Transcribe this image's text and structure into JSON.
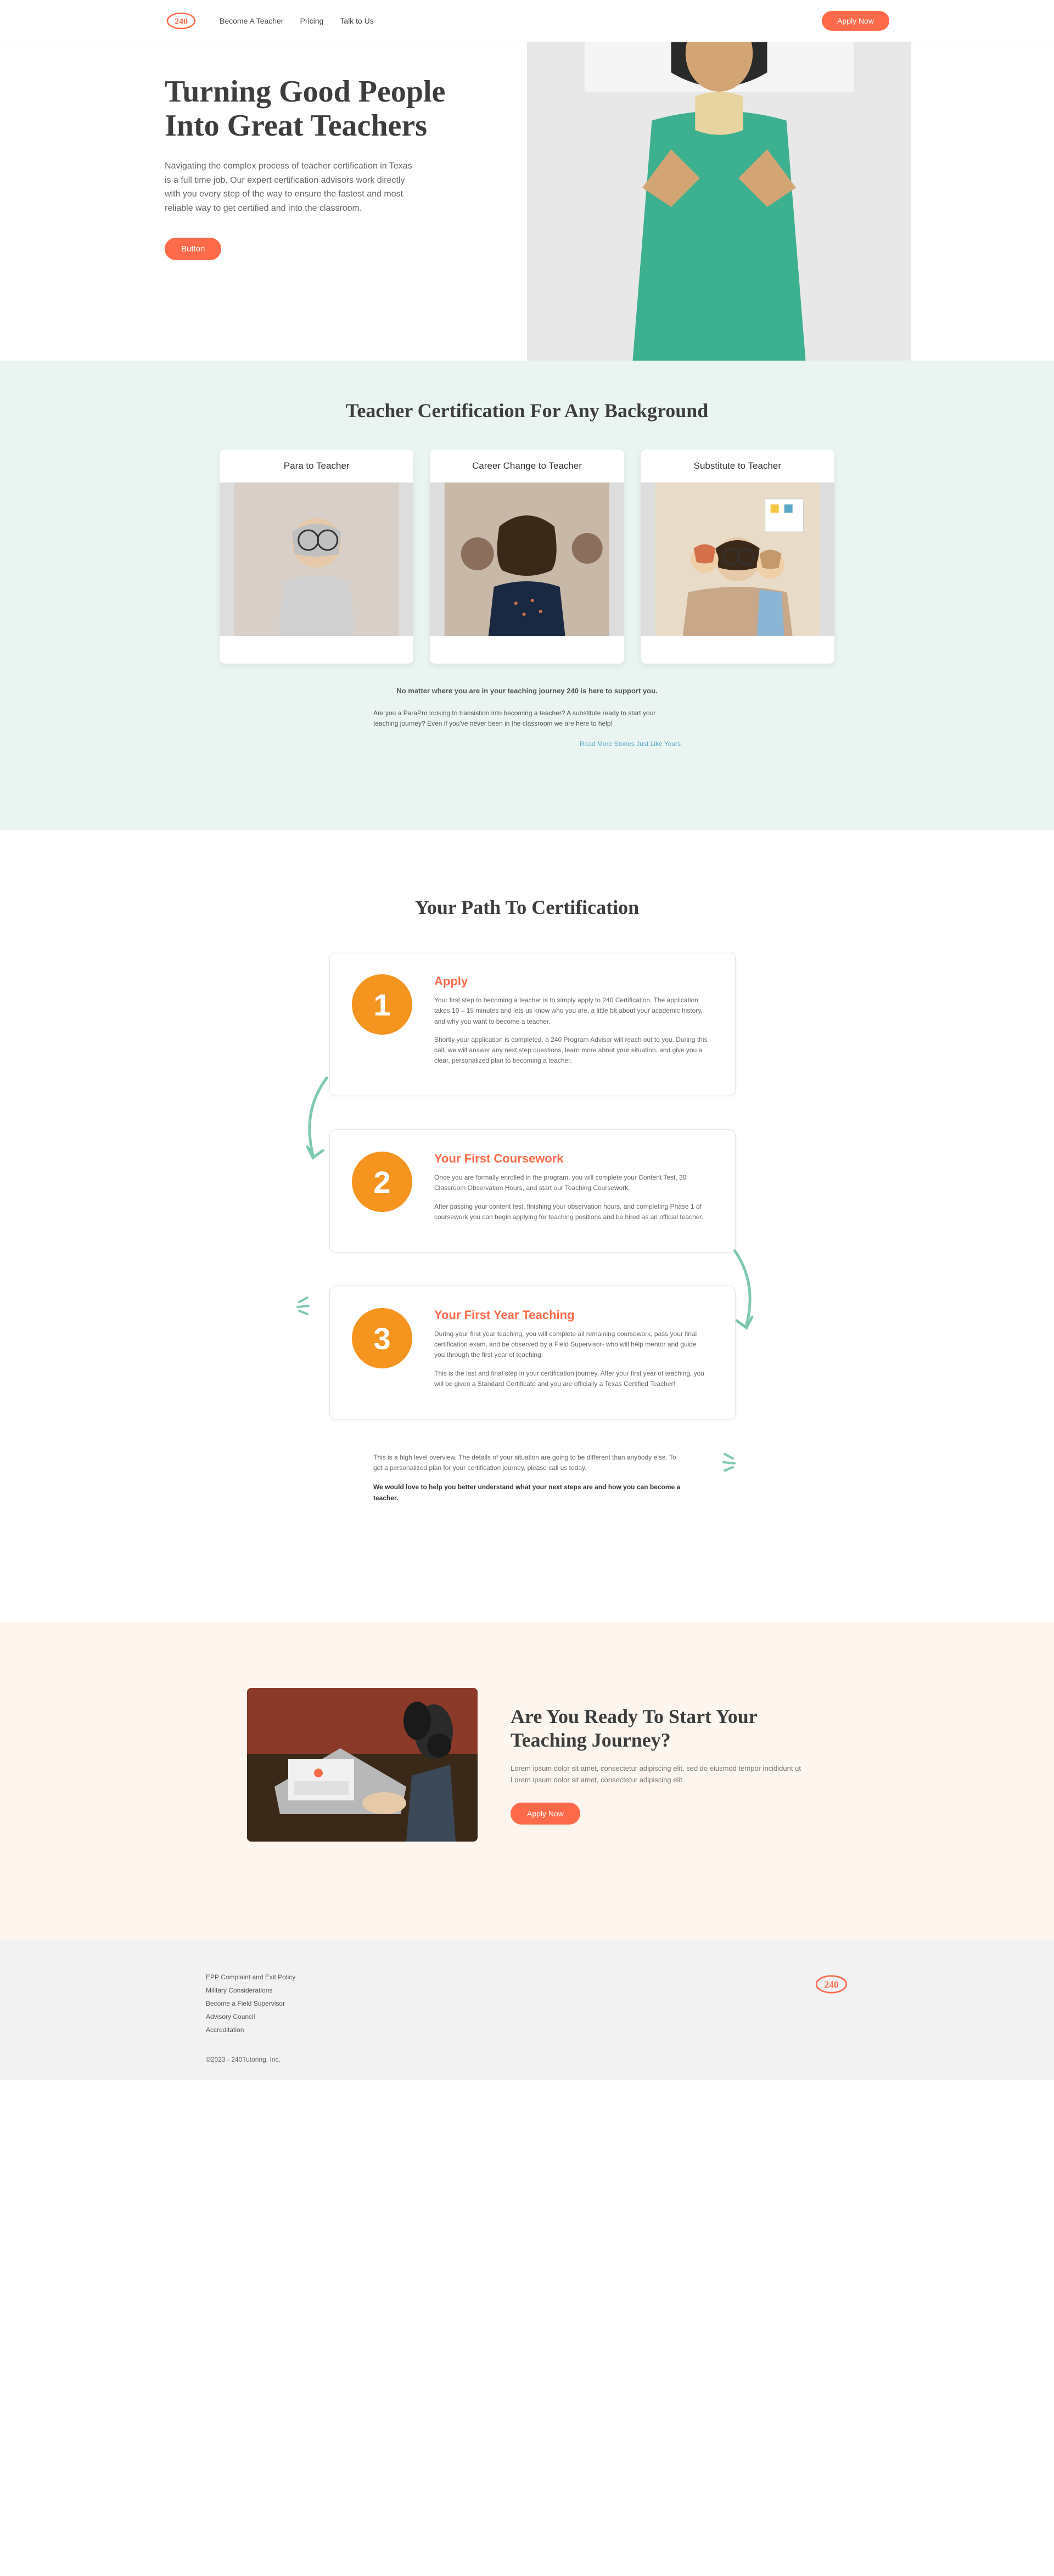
{
  "header": {
    "nav": [
      "Become A Teacher",
      "Pricing",
      "Talk to Us"
    ],
    "apply": "Apply Now"
  },
  "hero": {
    "title": "Turning Good People Into Great Teachers",
    "body": "Navigating the complex process of teacher certification in Texas is a full time job. Our expert certification advisors work directly with you every step of the way to ensure the fastest and most reliable way to get certified and into the classroom.",
    "button": "Button"
  },
  "backgrounds": {
    "title": "Teacher Certification For Any Background",
    "cards": [
      "Para to Teacher",
      "Career Change to Teacher",
      "Substitute to Teacher"
    ],
    "bold": "No matter where you are in your teaching journey 240 is here to support you.",
    "body": "Are you a ParaPro looking to transistion into becoming a teacher? A substitute ready to start your teaching journey? Even if you've never been in the classroom we are here to help!",
    "link": "Read More Stories Just Like Yours"
  },
  "path": {
    "title": "Your Path To Certification",
    "steps": [
      {
        "num": "1",
        "title": "Apply",
        "p1": "Your first step to becoming a teacher is to simply apply to 240 Certification. The application takes 10 – 15 minutes and lets us know who you are, a little bit about your academic history, and why you want to become a teacher.",
        "p2": "Shortly your application is completed, a 240 Program Advisor will reach out to you. During this call, we will answer any next step questions, learn more about your situation, and give you a clear, personalized plan to becoming a teacher."
      },
      {
        "num": "2",
        "title": "Your First Coursework",
        "p1": "Once you are formally enrolled in the program, you will complete your Content Test, 30 Classroom Observation Hours, and start our Teaching Coursework.",
        "p2": "After passing your content test, finishing your observation hours, and completing Phase 1 of coursework you can begin applying for teaching positions and be hired as an official teacher."
      },
      {
        "num": "3",
        "title": "Your First Year Teaching",
        "p1": "During your first year teaching, you will complete all remaining coursework, pass your final certification exam, and be observed by a Field Supervisor- who will help mentor and guide you through the first year of teaching.",
        "p2": "This is the last and final step in your certification journey. After your first year of teaching, you will be given a Standard Certificate and you are officially a Texas Certified Teacher!"
      }
    ],
    "footer1": "This is a high level overview. The details of your situation are going to be different than anybody else. To get a personalized plan for your certification journey, please call us today.",
    "footer2": "We would love to help you better understand what your next steps are and how you can become a teacher."
  },
  "cta": {
    "title": "Are You Ready To Start Your Teaching Journey?",
    "body": "Lorem ipsum dolor sit amet, consectetur adipiscing elit, sed do eiusmod tempor incididunt ut Lorem ipsum dolor sit amet, consectetur adipiscing elit",
    "button": "Apply Now"
  },
  "footer": {
    "links": [
      "EPP Complaint and Exit Policy",
      "Military Considerations",
      "Become a Field Supervisor",
      "Advisory Council",
      "Accreditation"
    ],
    "copyright": "©2023 - 240Tutoring, Inc."
  }
}
